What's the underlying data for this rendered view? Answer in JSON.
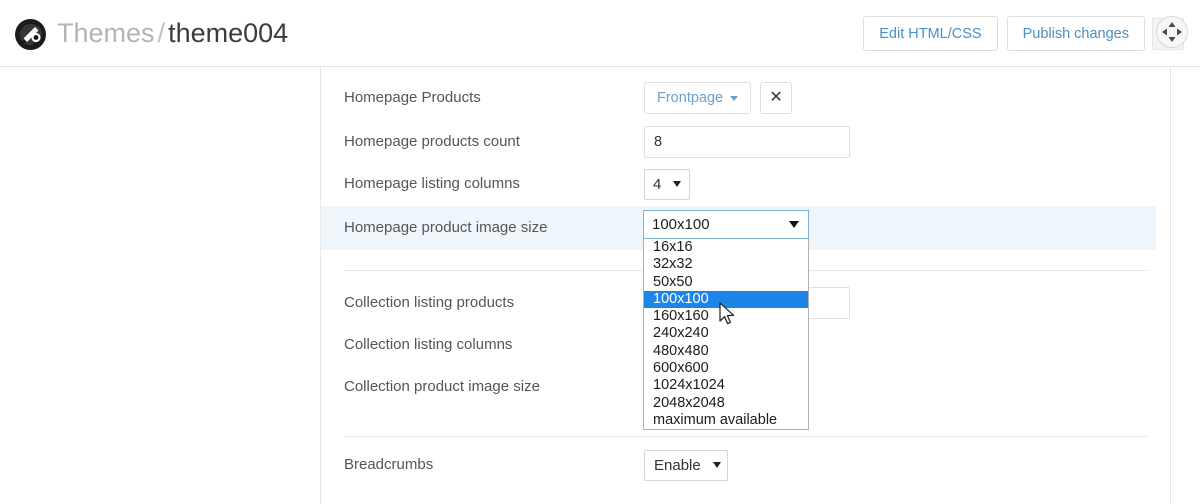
{
  "header": {
    "logo_icon": "palette-icon",
    "breadcrumb": {
      "parent": "Themes",
      "separator": "/",
      "current": "theme004"
    },
    "actions": {
      "edit_html_css": "Edit HTML/CSS",
      "publish_changes": "Publish changes",
      "nav_pad_icon": "move-arrows-icon"
    },
    "link_color": "#4a90c4"
  },
  "form": {
    "rows": [
      {
        "label": "Homepage Products",
        "control": "pill",
        "value": "Frontpage",
        "clear_label": "✕"
      },
      {
        "label": "Homepage products count",
        "control": "text",
        "value": "8",
        "placeholder": ""
      },
      {
        "label": "Homepage listing columns",
        "control": "mini-select",
        "value": "4"
      },
      {
        "label": "Homepage product image size",
        "control": "open-select",
        "value": "100x100",
        "highlighted": true
      },
      {
        "label": "Collection listing products",
        "control": "text",
        "value": "",
        "placeholder": ""
      },
      {
        "label": "Collection listing columns",
        "control": "hidden-select",
        "value": ""
      },
      {
        "label": "Collection product image size",
        "control": "hidden-select",
        "value": ""
      },
      {
        "label": "Breadcrumbs",
        "control": "wide-select",
        "value": "Enable"
      }
    ]
  },
  "image_size_dropdown": {
    "selected": "100x100",
    "options": [
      "16x16",
      "32x32",
      "50x50",
      "100x100",
      "160x160",
      "240x240",
      "480x480",
      "600x600",
      "1024x1024",
      "2048x2048",
      "maximum available"
    ],
    "highlight_color": "#1e85e8",
    "focus_border_color": "#7fb2d8"
  },
  "colors": {
    "page_bg": "#ffffff",
    "row_highlight": "#eef6fc",
    "border": "#e8e8e8",
    "label_text": "#555555"
  }
}
